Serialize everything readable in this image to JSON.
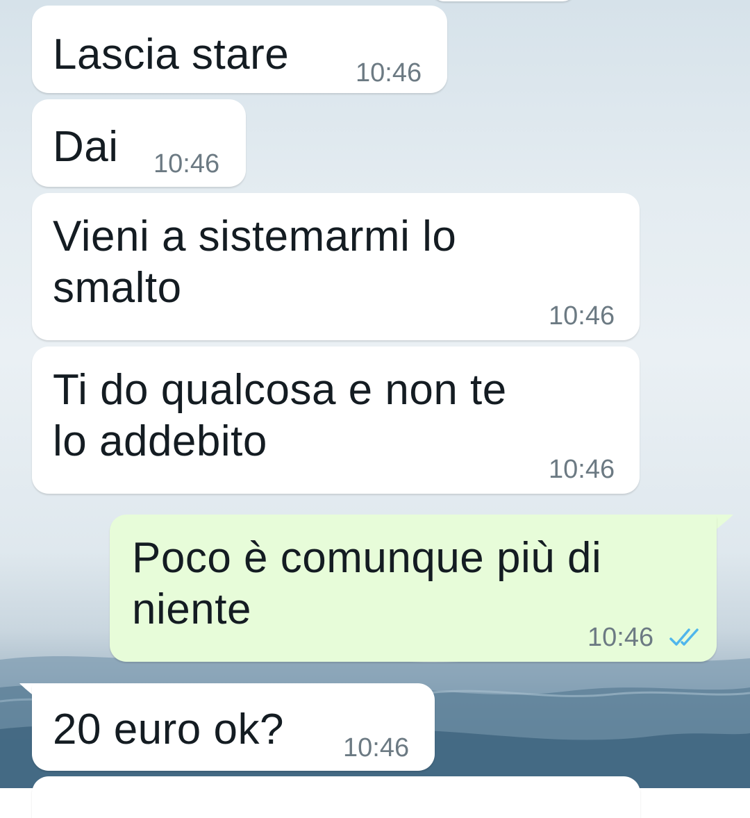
{
  "chat": {
    "wallpaper": "sea-landscape",
    "colors": {
      "incoming_bubble": "#ffffff",
      "outgoing_bubble": "#e7fcd9",
      "text": "#141c22",
      "time": "#6c7a83",
      "read_ticks": "#4fb6ec"
    },
    "messages": [
      {
        "direction": "incoming",
        "text": "Lascia stare",
        "time": "10:46"
      },
      {
        "direction": "incoming",
        "text": "Dai",
        "time": "10:46"
      },
      {
        "direction": "incoming",
        "text": "Vieni a sistemarmi lo\nsmalto",
        "time": "10:46"
      },
      {
        "direction": "incoming",
        "text": "Ti do qualcosa e non te\nlo addebito",
        "time": "10:46"
      },
      {
        "direction": "outgoing",
        "text": "Poco è comunque più di\nniente",
        "time": "10:46",
        "status": "read",
        "status_icon": "double-check-icon"
      },
      {
        "direction": "incoming",
        "text": "20 euro ok?",
        "time": "10:46"
      }
    ]
  }
}
